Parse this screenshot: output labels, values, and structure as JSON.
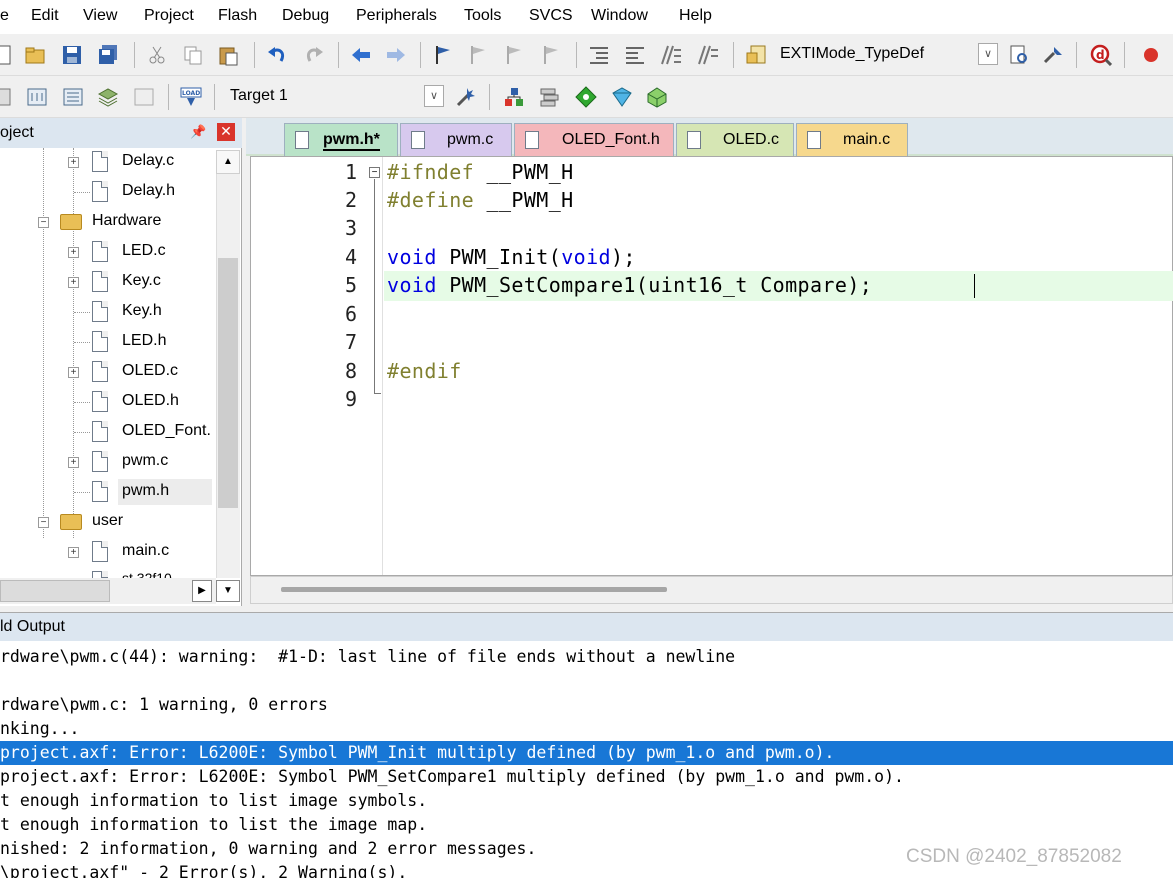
{
  "menu": [
    "e",
    "Edit",
    "View",
    "Project",
    "Flash",
    "Debug",
    "Peripherals",
    "Tools",
    "SVCS",
    "Window",
    "Help"
  ],
  "toolbar1": {
    "function_combo": "EXTIMode_TypeDef"
  },
  "toolbar2": {
    "target_combo": "Target 1",
    "load_label": "LOAD"
  },
  "project": {
    "title": "oject",
    "items": [
      {
        "label": "Delay.c",
        "kind": "file",
        "expandable": true
      },
      {
        "label": "Delay.h",
        "kind": "file",
        "expandable": false
      },
      {
        "label": "Hardware",
        "kind": "folder",
        "expandable": true
      },
      {
        "label": "LED.c",
        "kind": "file",
        "expandable": true
      },
      {
        "label": "Key.c",
        "kind": "file",
        "expandable": true
      },
      {
        "label": "Key.h",
        "kind": "file",
        "expandable": false
      },
      {
        "label": "LED.h",
        "kind": "file",
        "expandable": false
      },
      {
        "label": "OLED.c",
        "kind": "file",
        "expandable": true
      },
      {
        "label": "OLED.h",
        "kind": "file",
        "expandable": false
      },
      {
        "label": "OLED_Font.",
        "kind": "file",
        "expandable": false
      },
      {
        "label": "pwm.c",
        "kind": "file",
        "expandable": true
      },
      {
        "label": "pwm.h",
        "kind": "file",
        "expandable": false
      },
      {
        "label": "user",
        "kind": "folder",
        "expandable": true
      },
      {
        "label": "main.c",
        "kind": "file",
        "expandable": true
      },
      {
        "label": "st 32f10",
        "kind": "file",
        "expandable": false
      }
    ]
  },
  "tabs": [
    {
      "label": "pwm.h*",
      "color": "#b9e3c8",
      "active": true
    },
    {
      "label": "pwm.c",
      "color": "#d7c9ee",
      "active": false
    },
    {
      "label": "OLED_Font.h",
      "color": "#f4b7bb",
      "active": false
    },
    {
      "label": "OLED.c",
      "color": "#d6e6b4",
      "active": false
    },
    {
      "label": "main.c",
      "color": "#f6d88d",
      "active": false
    }
  ],
  "code": {
    "line_numbers": [
      "1",
      "2",
      "3",
      "4",
      "5",
      "6",
      "7",
      "8",
      "9"
    ],
    "lines": [
      {
        "a": "#ifndef",
        "b": " __PWM_H"
      },
      {
        "a": "#define",
        "b": " __PWM_H"
      },
      {
        "a": "",
        "b": ""
      },
      {
        "a": "void",
        "b": " PWM_Init(",
        "c": "void",
        "d": ");"
      },
      {
        "a": "void",
        "b": " PWM_SetCompare1(uint16_t Compare);"
      },
      {
        "a": "",
        "b": ""
      },
      {
        "a": "",
        "b": ""
      },
      {
        "a": "#endif",
        "b": ""
      },
      {
        "a": "",
        "b": ""
      }
    ]
  },
  "build": {
    "title": "ld Output",
    "lines": [
      "rdware\\pwm.c(44): warning:  #1-D: last line of file ends without a newline",
      "",
      "rdware\\pwm.c: 1 warning, 0 errors",
      "nking...",
      "project.axf: Error: L6200E: Symbol PWM_Init multiply defined (by pwm_1.o and pwm.o).",
      "project.axf: Error: L6200E: Symbol PWM_SetCompare1 multiply defined (by pwm_1.o and pwm.o).",
      "t enough information to list image symbols.",
      "t enough information to list the image map.",
      "nished: 2 information, 0 warning and 2 error messages.",
      "\\project.axf\" - 2 Error(s), 2 Warning(s)."
    ],
    "selected_index": 4
  },
  "watermark": "CSDN @2402_87852082",
  "colors": {
    "selection": "#1877d6",
    "preprocessor": "#808030",
    "keyword": "#0000e0",
    "current_line": "#e6fbe6"
  }
}
